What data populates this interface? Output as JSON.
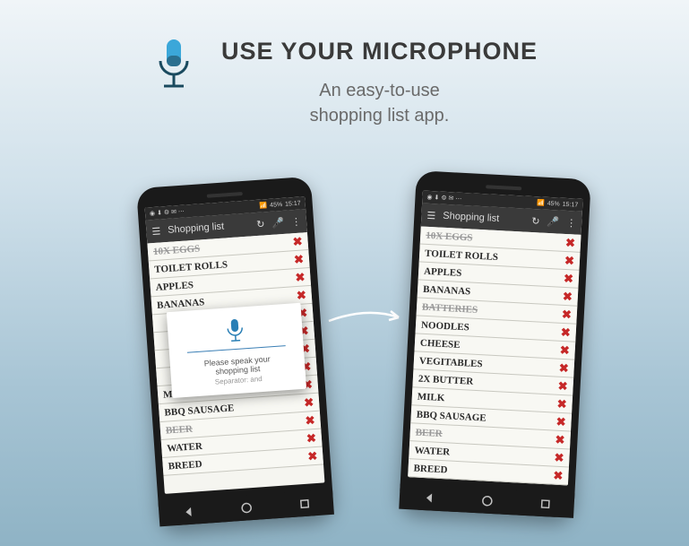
{
  "header": {
    "title": "USE YOUR MICROPHONE",
    "subtitle_l1": "An easy-to-use",
    "subtitle_l2": "shopping list app."
  },
  "status": {
    "battery": "45%",
    "time_left": "15:17",
    "time_right": "15:17"
  },
  "appbar": {
    "title": "Shopping list"
  },
  "popup": {
    "line1": "Please speak your",
    "line2": "shopping list",
    "line3": "Separator: and"
  },
  "left_list": [
    {
      "t": "10X EGGS",
      "s": true
    },
    {
      "t": "TOILET ROLLS",
      "s": false
    },
    {
      "t": "APPLES",
      "s": false
    },
    {
      "t": "BANANAS",
      "s": false
    },
    {
      "t": "",
      "s": false
    },
    {
      "t": "",
      "s": false
    },
    {
      "t": "",
      "s": false
    },
    {
      "t": "",
      "s": false
    },
    {
      "t": "MILK",
      "s": false
    },
    {
      "t": "BBQ SAUSAGE",
      "s": false
    },
    {
      "t": "BEER",
      "s": true
    },
    {
      "t": "WATER",
      "s": false
    },
    {
      "t": "BREED",
      "s": false
    }
  ],
  "right_list": [
    {
      "t": "10X EGGS",
      "s": true
    },
    {
      "t": "TOILET ROLLS",
      "s": false
    },
    {
      "t": "APPLES",
      "s": false
    },
    {
      "t": "BANANAS",
      "s": false
    },
    {
      "t": "BATTERIES",
      "s": true
    },
    {
      "t": "NOODLES",
      "s": false
    },
    {
      "t": "CHEESE",
      "s": false
    },
    {
      "t": "VEGITABLES",
      "s": false
    },
    {
      "t": "2X BUTTER",
      "s": false
    },
    {
      "t": "MILK",
      "s": false
    },
    {
      "t": "BBQ SAUSAGE",
      "s": false
    },
    {
      "t": "BEER",
      "s": true
    },
    {
      "t": "WATER",
      "s": false
    },
    {
      "t": "BREED",
      "s": false
    }
  ]
}
